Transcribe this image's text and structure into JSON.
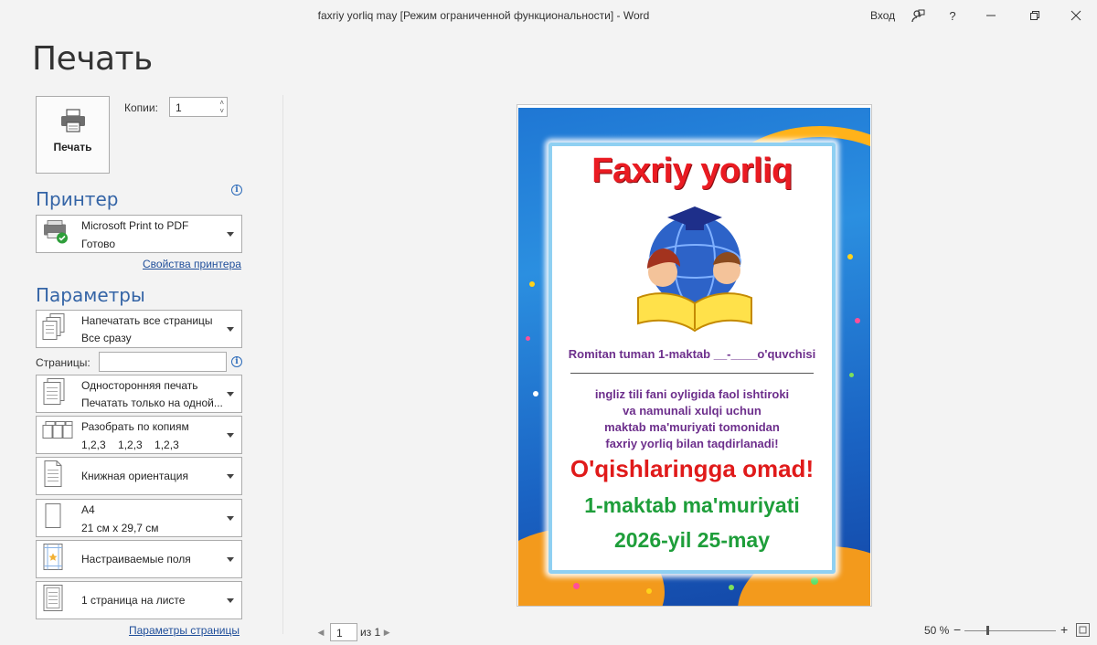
{
  "window": {
    "title": "faxriy yorliq may [Режим ограниченной функциональности]  -  Word",
    "login": "Вход",
    "help": "?"
  },
  "backstage": {
    "title": "Печать",
    "print_button": "Печать",
    "copies_label": "Копии:",
    "copies_value": "1"
  },
  "printer": {
    "heading": "Принтер",
    "name": "Microsoft Print to PDF",
    "status": "Готово",
    "properties_link": "Свойства принтера"
  },
  "settings": {
    "heading": "Параметры",
    "pages_label": "Страницы:",
    "pages_value": "",
    "items": [
      {
        "line1": "Напечатать все страницы",
        "line2": "Все сразу",
        "icon": "pages-icon"
      },
      {
        "line1": "Односторонняя печать",
        "line2": "Печатать только на одной...",
        "icon": "one-sided-icon"
      },
      {
        "line1": "Разобрать по копиям",
        "line2": "1,2,3    1,2,3    1,2,3",
        "icon": "collate-icon"
      },
      {
        "line1": "Книжная ориентация",
        "line2": "",
        "icon": "portrait-icon"
      },
      {
        "line1": "A4",
        "line2": "21 см x 29,7 см",
        "icon": "paper-size-icon"
      },
      {
        "line1": "Настраиваемые поля",
        "line2": "",
        "icon": "margins-icon"
      },
      {
        "line1": "1 страница на листе",
        "line2": "",
        "icon": "pages-per-sheet-icon"
      }
    ],
    "page_setup_link": "Параметры страницы"
  },
  "preview": {
    "title": "Faxriy yorliq",
    "line1": "Romitan tuman 1-maktab __-____o'quvchisi",
    "body": [
      "ingliz tili fani oyligida faol ishtiroki",
      "va namunali xulqi uchun",
      "maktab ma'muriyati tomonidan",
      "faxriy yorliq bilan taqdirlanadi!"
    ],
    "wish": "O'qishlaringga omad!",
    "signature": "1-maktab ma'muriyati",
    "date": "2026-yil 25-may"
  },
  "footer": {
    "page_current": "1",
    "page_total": "из 1",
    "zoom": "50 %",
    "zoom_minus": "−",
    "zoom_plus": "+"
  }
}
